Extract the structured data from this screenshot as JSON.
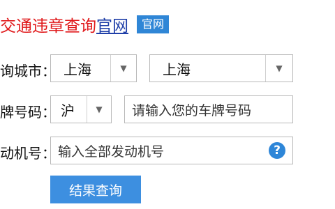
{
  "header": {
    "title_red": "交通违章查询",
    "title_blue": "官网",
    "badge": "官网"
  },
  "form": {
    "city_label": "询城市：",
    "province_value": "上海",
    "city_value": "上海",
    "plate_label": "牌号码：",
    "plate_prefix": "沪",
    "plate_placeholder": "请输入您的车牌号码",
    "engine_label": "动机号：",
    "engine_placeholder": "输入全部发动机号",
    "help_symbol": "?"
  },
  "actions": {
    "submit_label": "结果查询"
  },
  "icons": {
    "dropdown": "chevron-down-icon",
    "help": "question-circle-icon"
  },
  "colors": {
    "title_red": "#e0191b",
    "title_blue": "#1f3fa8",
    "accent": "#3d8fe0"
  }
}
